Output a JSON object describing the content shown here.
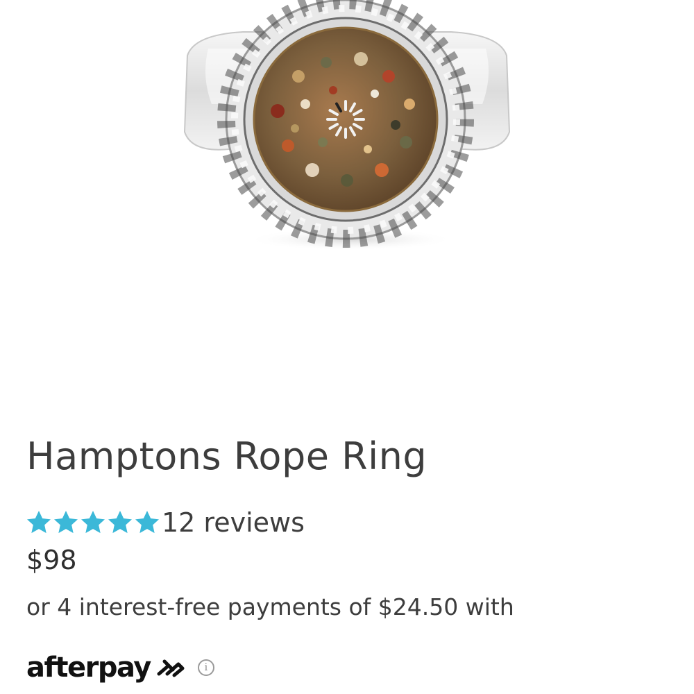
{
  "product": {
    "title": "Hamptons Rope Ring",
    "image_alt": "Hamptons Rope Ring",
    "rating": {
      "stars": 5,
      "max_stars": 5,
      "reviews_label": "12 reviews",
      "star_color": "#3bb8d8"
    },
    "price": "$98",
    "installments_text": "or 4 interest-free payments of $24.50 with"
  },
  "afterpay": {
    "wordmark": "afterpay",
    "logo_icon": "afterpay-arrows-icon",
    "info_symbol": "i",
    "info_icon": "info-circle-icon"
  },
  "colors": {
    "text": "#3d3d3d",
    "star": "#3bb8d8",
    "afterpay_logo": "#111111"
  }
}
